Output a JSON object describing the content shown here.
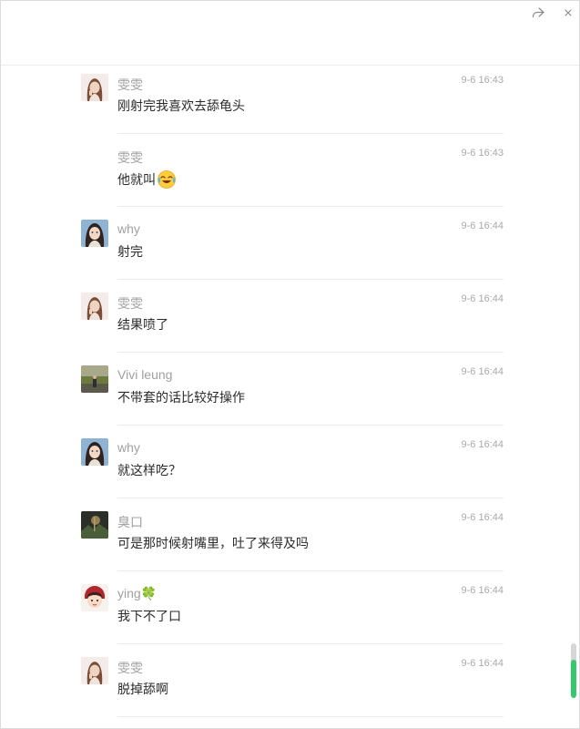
{
  "window": {
    "icons": {
      "share": "share-icon",
      "close": "close-icon"
    }
  },
  "messages": [
    {
      "name": "雯雯",
      "time": "9-6 16:43",
      "text": "刚射完我喜欢去舔龟头",
      "avatar": "avatar-wenwen"
    },
    {
      "name": "雯雯",
      "time": "9-6 16:43",
      "text": "他就叫",
      "emoji": "laugh-cry-emoji",
      "avatar": ""
    },
    {
      "name": "why",
      "time": "9-6 16:44",
      "text": "射完",
      "avatar": "avatar-why"
    },
    {
      "name": "雯雯",
      "time": "9-6 16:44",
      "text": "结果喷了",
      "avatar": "avatar-wenwen"
    },
    {
      "name": "Vivi leung",
      "time": "9-6 16:44",
      "text": "不带套的话比较好操作",
      "avatar": "avatar-vivi"
    },
    {
      "name": "why",
      "time": "9-6 16:44",
      "text": "就这样吃？",
      "avatar": "avatar-why"
    },
    {
      "name": "臭口",
      "time": "9-6 16:44",
      "text": "可是那时候射嘴里，吐了来得及吗",
      "avatar": "avatar-chou"
    },
    {
      "name": "ying🍀",
      "time": "9-6 16:44",
      "text": "我下不了口",
      "avatar": "avatar-ying"
    },
    {
      "name": "雯雯",
      "time": "9-6 16:44",
      "text": "脱掉舔啊",
      "avatar": "avatar-wenwen"
    }
  ],
  "scrollbar": {
    "position": 0.7,
    "accent": "#35c96b"
  }
}
